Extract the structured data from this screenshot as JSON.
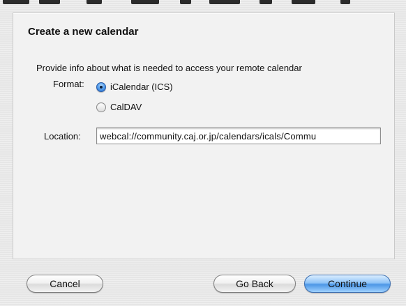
{
  "dialog": {
    "title": "Create a new calendar",
    "instructions": "Provide info about what is needed to access your remote calendar",
    "format": {
      "label": "Format:",
      "options": [
        {
          "label": "iCalendar (ICS)",
          "selected": true
        },
        {
          "label": "CalDAV",
          "selected": false
        }
      ]
    },
    "location": {
      "label": "Location:",
      "value": "webcal://community.caj.or.jp/calendars/icals/Commu"
    },
    "buttons": {
      "cancel": "Cancel",
      "go_back": "Go Back",
      "continue": "Continue"
    }
  },
  "colors": {
    "accent": "#4d97e6",
    "panel": "#f2f2f2",
    "window": "#e6e6e6"
  }
}
